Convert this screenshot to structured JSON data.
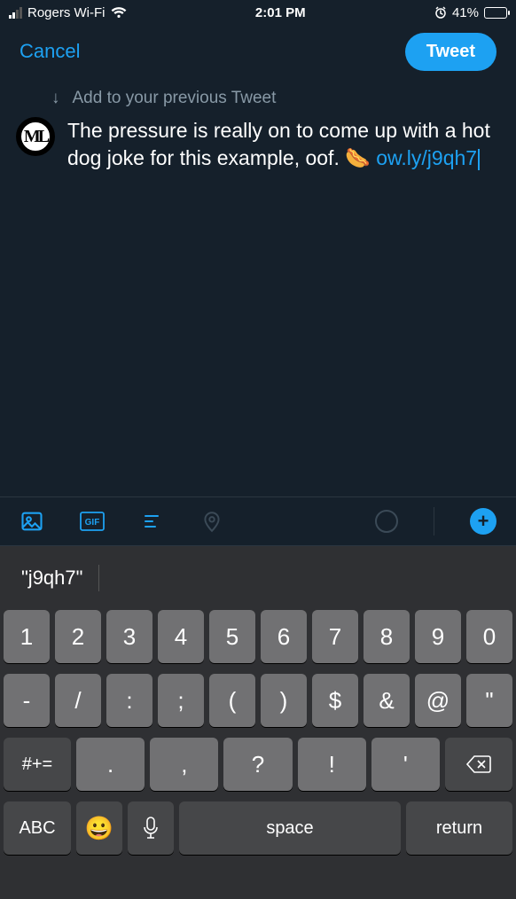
{
  "status_bar": {
    "carrier": "Rogers Wi-Fi",
    "time": "2:01 PM",
    "battery_pct": "41%"
  },
  "nav": {
    "cancel": "Cancel",
    "tweet": "Tweet"
  },
  "compose": {
    "add_previous": "Add to your previous Tweet",
    "avatar_initials": "ML",
    "text_plain": "The pressure is really on to come up with a hot dog joke for this example, oof. ",
    "emoji": "🌭",
    "link": "ow.ly/j9qh7"
  },
  "suggestion": {
    "word": "\"j9qh7\""
  },
  "keyboard": {
    "row1": [
      "1",
      "2",
      "3",
      "4",
      "5",
      "6",
      "7",
      "8",
      "9",
      "0"
    ],
    "row2": [
      "-",
      "/",
      ":",
      ";",
      "(",
      ")",
      "$",
      "&",
      "@",
      "\""
    ],
    "row3_shift": "#+=",
    "row3": [
      ".",
      ",",
      "?",
      "!",
      "'"
    ],
    "abc": "ABC",
    "space": "space",
    "return": "return"
  }
}
